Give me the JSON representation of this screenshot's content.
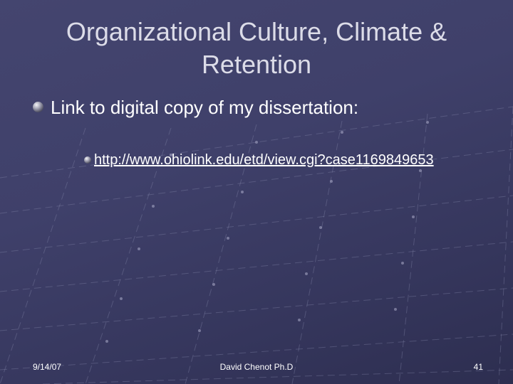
{
  "slide": {
    "title": "Organizational Culture, Climate  & Retention",
    "bullet_text": "Link to digital copy of my dissertation:",
    "link_text": "http://www.ohiolink.edu/etd/view.cgi?case1169849653",
    "footer": {
      "date": "9/14/07",
      "author": "David Chenot Ph.D",
      "page_number": "41"
    }
  },
  "colors": {
    "background": "#3f406a",
    "title_text": "#dcdce8",
    "body_text": "#ffffff"
  },
  "icons": {
    "bullet": "sphere-bullet-icon"
  }
}
